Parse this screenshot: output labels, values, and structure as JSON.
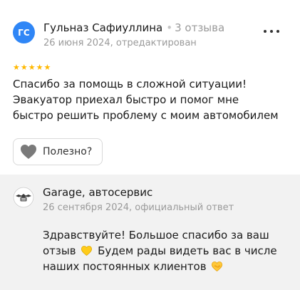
{
  "review": {
    "avatar_initials": "ГС",
    "avatar_color": "#2f86f6",
    "author_name": "Гульназ Сафиуллина",
    "separator": "•",
    "reviews_count": "3 отзыва",
    "meta": "26 июня 2024, отредактирован",
    "rating": 5,
    "star_glyph": "★",
    "text_lines": [
      "Спасибо за помощь в сложной ситуации!",
      "Эвакуатор приехал быстро и помог мне",
      "быстро решить проблему с моим автомобилем"
    ],
    "useful_label": "Полезно?",
    "more_icon": "more-horizontal-icon",
    "useful_icon": "heart-icon"
  },
  "reply": {
    "logo_icon": "garage-logo",
    "business_name": "Garage, автосервис",
    "meta": "26 сентября 2024, официальный ответ",
    "line1": "Здравствуйте! Большое спасибо за ваш",
    "line2_before": "отзыв",
    "line2_after": "Будем рады видеть вас в числе",
    "line3": "наших постоянных клиентов",
    "emoji_1": "yellow-heart-emoji",
    "emoji_2": "handshake-heart-emoji"
  },
  "colors": {
    "star": "#ffb800",
    "reply_background": "#f2f2f2",
    "muted_text": "#9a9a9a"
  }
}
